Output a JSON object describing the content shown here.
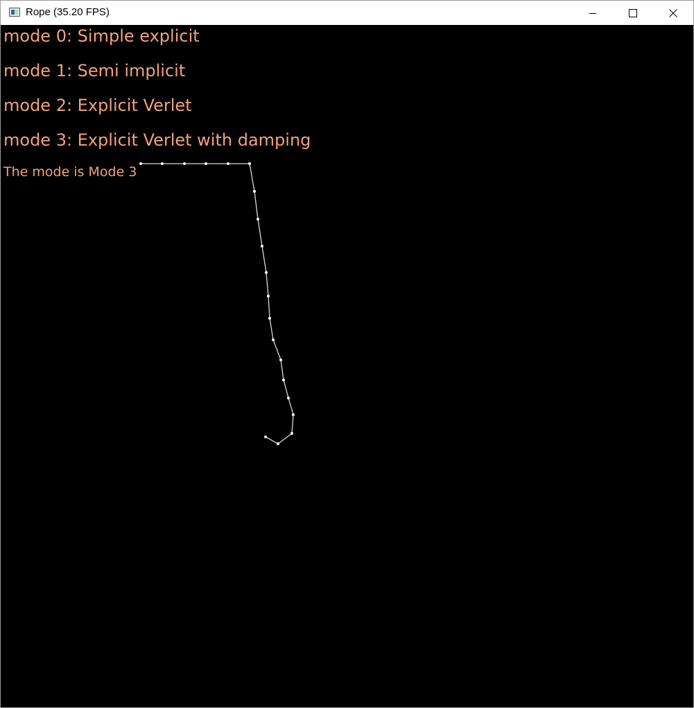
{
  "window": {
    "title": "Rope (35.20 FPS)",
    "app_icon": "application-window-icon",
    "controls": {
      "minimize_icon": "minimize-icon",
      "maximize_icon": "maximize-icon",
      "close_icon": "close-icon"
    }
  },
  "canvas": {
    "background": "#000000",
    "text_color": "#f2a27a",
    "rope_color": "#ffffff",
    "modes": [
      "mode 0: Simple explicit",
      "mode 1: Semi implicit",
      "mode 2: Explicit Verlet",
      "mode 3: Explicit Verlet with damping"
    ],
    "status": "The mode is Mode 3"
  }
}
